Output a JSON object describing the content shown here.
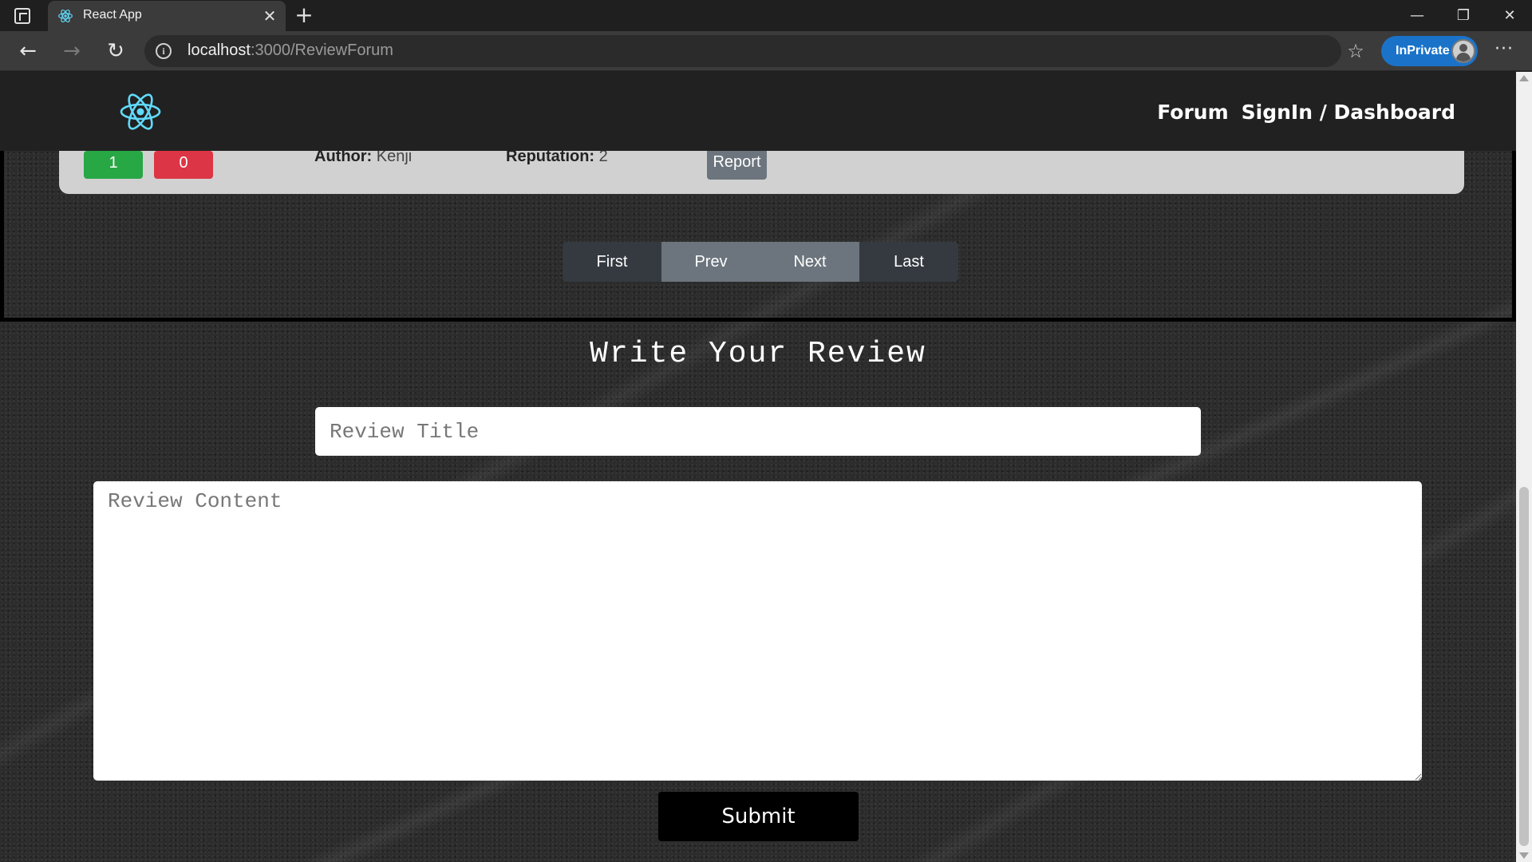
{
  "browser": {
    "tab_title": "React App",
    "tab_close_glyph": "✕",
    "new_tab_glyph": "+",
    "url_host": "localhost",
    "url_rest": ":3000/ReviewForum",
    "inprivate_label": "InPrivate",
    "window_controls": {
      "minimize": "—",
      "restore": "❐",
      "close": "✕"
    },
    "nav_icons": {
      "back": "←",
      "forward": "→",
      "refresh": "↻",
      "favorites": "☆",
      "more": "···"
    }
  },
  "site": {
    "nav_links": [
      "Forum",
      "SignIn / Dashboard"
    ]
  },
  "review_card": {
    "upvotes": "1",
    "downvotes": "0",
    "author_label": "Author:",
    "author_value": "Kenji",
    "reputation_label": "Reputation:",
    "reputation_value": "2",
    "report_label": "Report"
  },
  "pagination": {
    "first": "First",
    "prev": "Prev",
    "next": "Next",
    "last": "Last"
  },
  "review_form": {
    "heading": "Write Your Review",
    "title_placeholder": "Review Title",
    "content_placeholder": "Review Content",
    "submit_label": "Submit"
  },
  "colors": {
    "upvote": "#28a745",
    "downvote": "#dc3545",
    "secondary": "#6c757d",
    "dark": "#343a40",
    "react_logo": "#61dafb",
    "inprivate": "#1a73c9"
  }
}
